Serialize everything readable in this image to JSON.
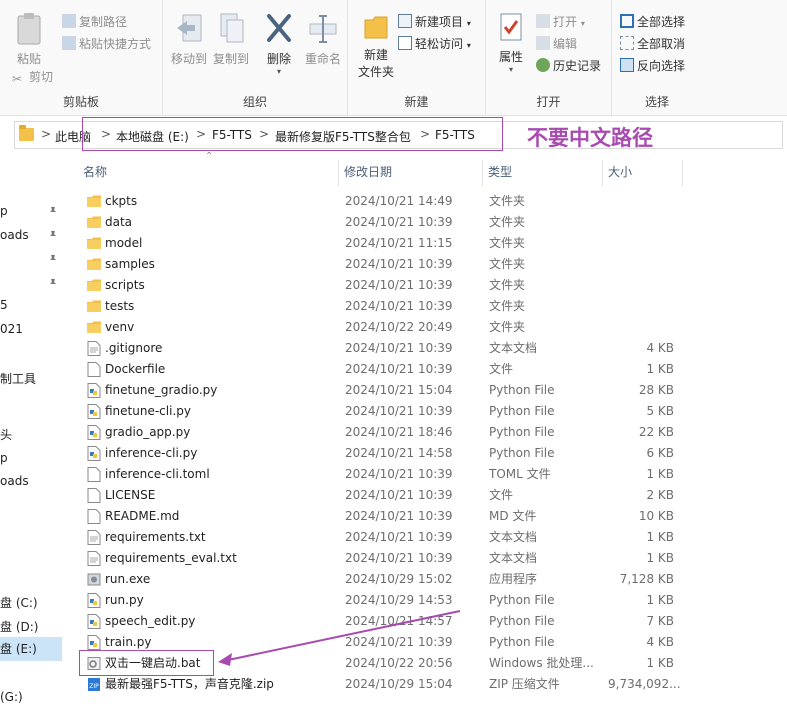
{
  "ribbon": {
    "clipboard": {
      "label": "剪贴板",
      "pin": "粘贴",
      "copy_path": "复制路径",
      "paste_shortcut": "粘贴快捷方式",
      "cut": "剪切"
    },
    "organize": {
      "label": "组织",
      "move_to": "移动到",
      "copy_to": "复制到",
      "delete": "删除",
      "rename": "重命名"
    },
    "new": {
      "label": "新建",
      "new_folder_line1": "新建",
      "new_folder_line2": "文件夹",
      "new_item": "新建项目",
      "easy_access": "轻松访问"
    },
    "open": {
      "label": "打开",
      "properties": "属性",
      "open": "打开",
      "edit": "编辑",
      "history": "历史记录"
    },
    "select": {
      "label": "选择",
      "select_all": "全部选择",
      "select_none": "全部取消",
      "invert": "反向选择"
    }
  },
  "address": {
    "crumbs": [
      "此电脑",
      "本地磁盘 (E:)",
      "F5-TTS",
      "最新修复版F5-TTS整合包",
      "F5-TTS"
    ],
    "separator": ">"
  },
  "annotation": {
    "text": "不要中文路径",
    "color": "#a84bb1"
  },
  "sidebar": {
    "items": [
      "p",
      "oads",
      "",
      "",
      "5",
      "021",
      "制工具",
      "",
      "头",
      "p",
      "oads",
      "",
      "",
      "盘 (C:)",
      "盘 (D:)",
      "盘 (E:)",
      "",
      "(G:)"
    ]
  },
  "columns": {
    "name": "名称",
    "date": "修改日期",
    "type": "类型",
    "size": "大小"
  },
  "files": [
    {
      "name": "ckpts",
      "date": "2024/10/21 14:49",
      "type": "文件夹",
      "size": "",
      "icon": "folder-icon"
    },
    {
      "name": "data",
      "date": "2024/10/21 10:39",
      "type": "文件夹",
      "size": "",
      "icon": "folder-icon"
    },
    {
      "name": "model",
      "date": "2024/10/21 11:15",
      "type": "文件夹",
      "size": "",
      "icon": "folder-icon"
    },
    {
      "name": "samples",
      "date": "2024/10/21 10:39",
      "type": "文件夹",
      "size": "",
      "icon": "folder-icon"
    },
    {
      "name": "scripts",
      "date": "2024/10/21 10:39",
      "type": "文件夹",
      "size": "",
      "icon": "folder-icon"
    },
    {
      "name": "tests",
      "date": "2024/10/21 10:39",
      "type": "文件夹",
      "size": "",
      "icon": "folder-icon"
    },
    {
      "name": "venv",
      "date": "2024/10/22 20:49",
      "type": "文件夹",
      "size": "",
      "icon": "folder-icon"
    },
    {
      "name": ".gitignore",
      "date": "2024/10/21 10:39",
      "type": "文本文档",
      "size": "4 KB",
      "icon": "text-file-icon"
    },
    {
      "name": "Dockerfile",
      "date": "2024/10/21 10:39",
      "type": "文件",
      "size": "1 KB",
      "icon": "file-icon"
    },
    {
      "name": "finetune_gradio.py",
      "date": "2024/10/21 15:04",
      "type": "Python File",
      "size": "28 KB",
      "icon": "python-file-icon"
    },
    {
      "name": "finetune-cli.py",
      "date": "2024/10/21 10:39",
      "type": "Python File",
      "size": "5 KB",
      "icon": "python-file-icon"
    },
    {
      "name": "gradio_app.py",
      "date": "2024/10/21 18:46",
      "type": "Python File",
      "size": "22 KB",
      "icon": "python-file-icon"
    },
    {
      "name": "inference-cli.py",
      "date": "2024/10/21 14:58",
      "type": "Python File",
      "size": "6 KB",
      "icon": "python-file-icon"
    },
    {
      "name": "inference-cli.toml",
      "date": "2024/10/21 10:39",
      "type": "TOML 文件",
      "size": "1 KB",
      "icon": "file-icon"
    },
    {
      "name": "LICENSE",
      "date": "2024/10/21 10:39",
      "type": "文件",
      "size": "2 KB",
      "icon": "file-icon"
    },
    {
      "name": "README.md",
      "date": "2024/10/21 10:39",
      "type": "MD 文件",
      "size": "10 KB",
      "icon": "file-icon"
    },
    {
      "name": "requirements.txt",
      "date": "2024/10/21 10:39",
      "type": "文本文档",
      "size": "1 KB",
      "icon": "text-file-icon"
    },
    {
      "name": "requirements_eval.txt",
      "date": "2024/10/21 10:39",
      "type": "文本文档",
      "size": "1 KB",
      "icon": "text-file-icon"
    },
    {
      "name": "run.exe",
      "date": "2024/10/29 15:02",
      "type": "应用程序",
      "size": "7,128 KB",
      "icon": "exe-icon"
    },
    {
      "name": "run.py",
      "date": "2024/10/29 14:53",
      "type": "Python File",
      "size": "1 KB",
      "icon": "python-file-icon"
    },
    {
      "name": "speech_edit.py",
      "date": "2024/10/21 14:57",
      "type": "Python File",
      "size": "7 KB",
      "icon": "python-file-icon"
    },
    {
      "name": "train.py",
      "date": "2024/10/21 10:39",
      "type": "Python File",
      "size": "4 KB",
      "icon": "python-file-icon"
    },
    {
      "name": "双击一键启动.bat",
      "date": "2024/10/22 20:56",
      "type": "Windows 批处理...",
      "size": "1 KB",
      "icon": "bat-file-icon"
    },
    {
      "name": "最新最强F5-TTS，声音克隆.zip",
      "date": "2024/10/29 15:04",
      "type": "ZIP 压缩文件",
      "size": "9,734,092...",
      "icon": "zip-file-icon"
    }
  ]
}
